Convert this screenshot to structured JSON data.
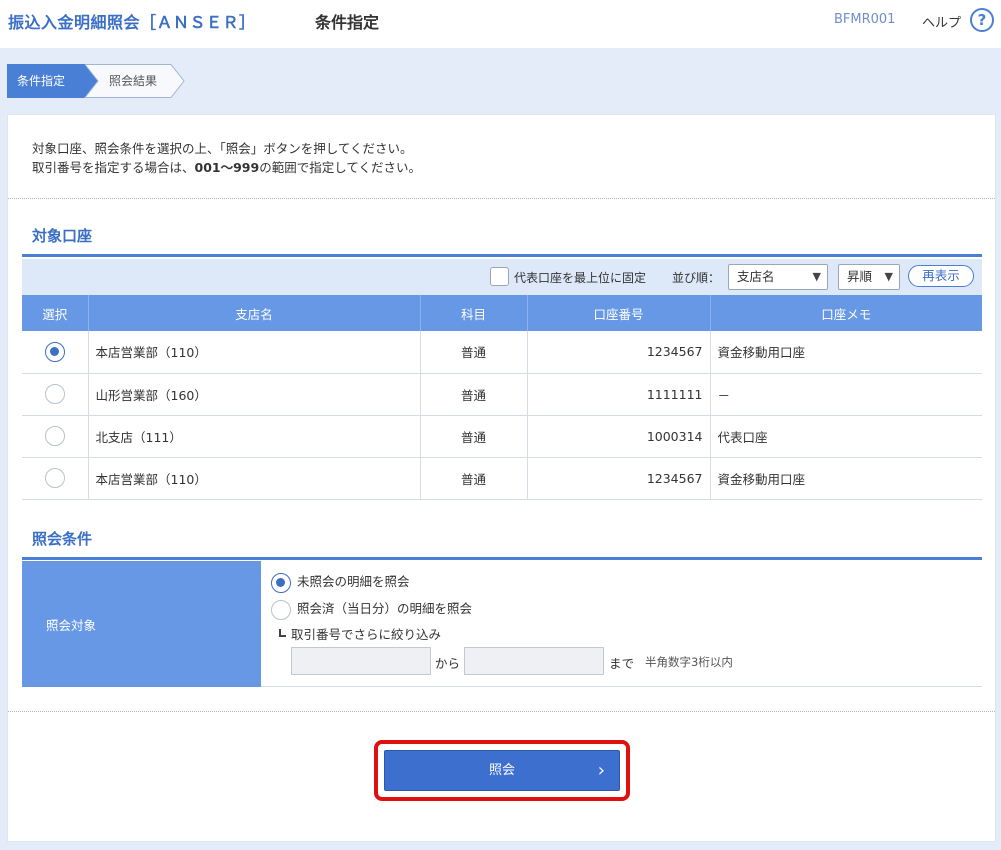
{
  "header": {
    "app_title": "振込入金明細照会［ＡＮＳＥＲ］",
    "screen_title": "条件指定",
    "screen_id": "BFMR001",
    "help_label": "ヘルプ",
    "help_icon_glyph": "?"
  },
  "steps": [
    {
      "label": "条件指定",
      "active": true
    },
    {
      "label": "照会結果",
      "active": false
    }
  ],
  "intro": {
    "line1": "対象口座、照会条件を選択の上、「照会」ボタンを押してください。",
    "line2_prefix": "取引番号を指定する場合は、",
    "line2_bold": "001～999",
    "line2_suffix": "の範囲で指定してください。"
  },
  "accounts_section": {
    "title": "対象口座",
    "fix_top_label": "代表口座を最上位に固定",
    "sort_label": "並び順：",
    "sort_by_selected": "支店名",
    "sort_order_selected": "昇順",
    "redisplay_label": "再表示",
    "columns": [
      "選択",
      "支店名",
      "科目",
      "口座番号",
      "口座メモ"
    ],
    "rows": [
      {
        "selected": true,
        "branch": "本店営業部（110）",
        "type": "普通",
        "number": "1234567",
        "memo": "資金移動用口座"
      },
      {
        "selected": false,
        "branch": "山形営業部（160）",
        "type": "普通",
        "number": "1111111",
        "memo": "－"
      },
      {
        "selected": false,
        "branch": "北支店（111）",
        "type": "普通",
        "number": "1000314",
        "memo": "代表口座"
      },
      {
        "selected": false,
        "branch": "本店営業部（110）",
        "type": "普通",
        "number": "1234567",
        "memo": "資金移動用口座"
      }
    ]
  },
  "conditions_section": {
    "title": "照会条件",
    "target_label": "照会対象",
    "option_unviewed": "未照会の明細を照会",
    "option_viewed": "照会済（当日分）の明細を照会",
    "narrow_label": "取引番号でさらに絞り込み",
    "from_value": "",
    "to_value": "",
    "kara_label": "から",
    "made_label": "まで",
    "hint": "半角数字3桁以内"
  },
  "submit": {
    "label": "照会",
    "chevron_glyph": "›",
    "highlight_color": "#e01010"
  },
  "colors": {
    "accent": "#3b6fc6",
    "table_header": "#6698e6",
    "page_background": "#e3ecf8"
  }
}
